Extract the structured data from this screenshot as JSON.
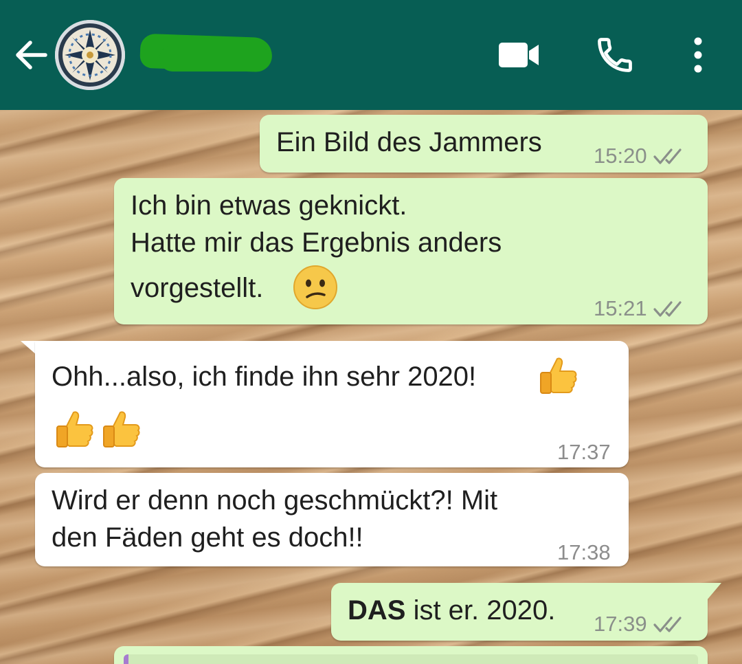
{
  "header": {
    "contact_name": "",
    "colors": {
      "bar": "#075e54",
      "icons": "#ffffff",
      "redaction": "#1ea31e"
    },
    "icons": [
      "arrow-left-icon",
      "avatar",
      "video-camera-icon",
      "phone-icon",
      "more-vertical-icon"
    ]
  },
  "messages": [
    {
      "direction": "outgoing",
      "lines": [
        "Ein Bild des Jammers"
      ],
      "time": "15:20",
      "status": "read"
    },
    {
      "direction": "outgoing",
      "lines": [
        "Ich bin etwas geknickt.",
        "Hatte mir das Ergebnis anders",
        "vorgestellt."
      ],
      "emoji": "confused-face-emoji",
      "time": "15:21",
      "status": "read"
    },
    {
      "direction": "incoming",
      "lines": [
        "Ohh...also, ich finde ihn sehr 2020!"
      ],
      "emoji": "thumbs-up-emoji x3",
      "time": "17:37"
    },
    {
      "direction": "incoming",
      "lines": [
        "Wird er denn noch geschmückt?! Mit",
        "den Fäden geht es doch!!"
      ],
      "time": "17:38"
    },
    {
      "direction": "outgoing",
      "bold": "DAS",
      "rest": " ist er. 2020.",
      "time": "17:39",
      "status": "read"
    }
  ],
  "colors": {
    "outgoing_bubble": "#dcf8c6",
    "incoming_bubble": "#ffffff",
    "read_ticks": "#8a8f8a"
  }
}
